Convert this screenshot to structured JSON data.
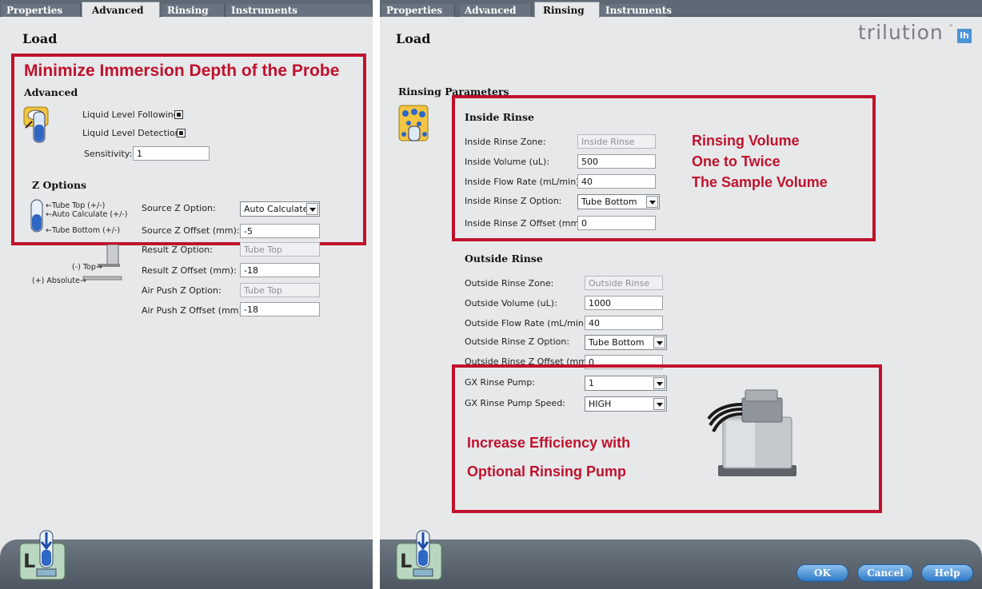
{
  "left": {
    "tabs": [
      "Properties",
      "Advanced",
      "Rinsing",
      "Instruments"
    ],
    "active_tab": "Advanced",
    "title": "Load",
    "callout": "Minimize Immersion Depth of the  Probe",
    "advanced_heading": "Advanced",
    "liquid_level_following": "Liquid Level Following",
    "liquid_level_detection": "Liquid Level Detection",
    "sensitivity_label": "Sensitivity:",
    "sensitivity_value": "1",
    "z_options_heading": "Z Options",
    "diagram": {
      "tube_top": "←Tube Top (+/-)",
      "auto_calc": "←Auto Calculate (+/-)",
      "tube_bottom": "←Tube Bottom (+/-)",
      "top": "(-) Top→",
      "absolute": "(+) Absolute→"
    },
    "fields": [
      {
        "label": "Source Z Option:",
        "value": "Auto Calculate",
        "type": "select"
      },
      {
        "label": "Source Z Offset (mm):",
        "value": "-5",
        "type": "input"
      },
      {
        "label": "Result Z Option:",
        "value": "Tube Top",
        "type": "disabled"
      },
      {
        "label": "Result Z Offset (mm):",
        "value": "-18",
        "type": "input"
      },
      {
        "label": "Air Push Z Option:",
        "value": "Tube Top",
        "type": "disabled"
      },
      {
        "label": "Air Push Z Offset (mm):",
        "value": "-18",
        "type": "input"
      }
    ]
  },
  "right": {
    "tabs": [
      "Properties",
      "Advanced",
      "Rinsing",
      "Instruments"
    ],
    "active_tab": "Rinsing",
    "title": "Load",
    "brand": "trilution",
    "brand_badge": "lh",
    "rinsing_params_heading": "Rinsing Parameters",
    "inside_heading": "Inside Rinse",
    "inside_fields": [
      {
        "label": "Inside Rinse Zone:",
        "value": "Inside Rinse",
        "type": "disabled"
      },
      {
        "label": "Inside Volume (uL):",
        "value": "500",
        "type": "input"
      },
      {
        "label": "Inside Flow Rate (mL/min):",
        "value": "40",
        "type": "input"
      },
      {
        "label": "Inside Rinse Z Option:",
        "value": "Tube Bottom",
        "type": "select"
      },
      {
        "label": "Inside Rinse Z Offset (mm):",
        "value": "0",
        "type": "input"
      }
    ],
    "callout_volume": [
      "Rinsing Volume",
      "One to Twice",
      "The Sample Volume"
    ],
    "outside_heading": "Outside Rinse",
    "outside_fields": [
      {
        "label": "Outside Rinse Zone:",
        "value": "Outside Rinse",
        "type": "disabled"
      },
      {
        "label": "Outside Volume (uL):",
        "value": "1000",
        "type": "input"
      },
      {
        "label": "Outside Flow Rate (mL/min):",
        "value": "40",
        "type": "input"
      },
      {
        "label": "Outside Rinse Z Option:",
        "value": "Tube Bottom",
        "type": "select"
      },
      {
        "label": "Outside Rinse Z Offset (mm):",
        "value": "0",
        "type": "input"
      }
    ],
    "pump_fields": [
      {
        "label": "GX Rinse Pump:",
        "value": "1",
        "type": "select"
      },
      {
        "label": "GX Rinse Pump Speed:",
        "value": "HIGH",
        "type": "select"
      }
    ],
    "callout_pump": [
      "Increase Efficiency with",
      "Optional Rinsing Pump"
    ],
    "buttons": {
      "ok": "OK",
      "cancel": "Cancel",
      "help": "Help"
    }
  }
}
